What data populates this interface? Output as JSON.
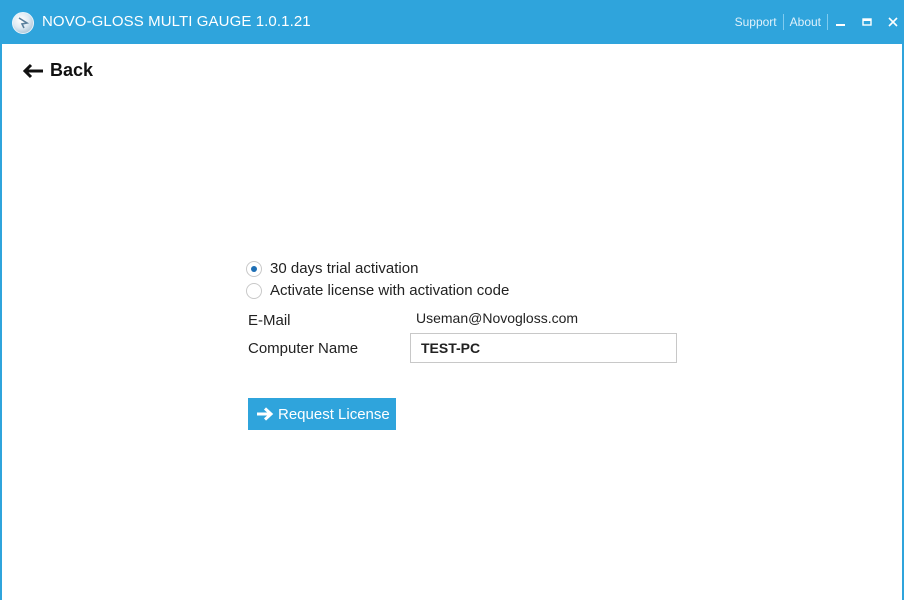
{
  "window": {
    "title": "NOVO-GLOSS MULTI GAUGE 1.0.1.21",
    "accent_color": "#2fa4dc",
    "logo_icon": "app-logo-icon"
  },
  "titlebar": {
    "support_label": "Support",
    "about_label": "About",
    "minimize_icon": "minimize-icon",
    "maximize_icon": "maximize-icon",
    "close_icon": "close-icon"
  },
  "nav": {
    "back_label": "Back",
    "back_icon": "arrow-left-icon"
  },
  "activation": {
    "options": [
      {
        "label": "30 days trial activation",
        "checked": true
      },
      {
        "label": "Activate license with activation code",
        "checked": false
      }
    ],
    "email_label": "E-Mail",
    "email_value": "Useman@Novogloss.com",
    "computer_name_label": "Computer Name",
    "computer_name_value": "TEST-PC",
    "request_button_label": "Request License",
    "request_button_icon": "arrow-right-icon"
  }
}
